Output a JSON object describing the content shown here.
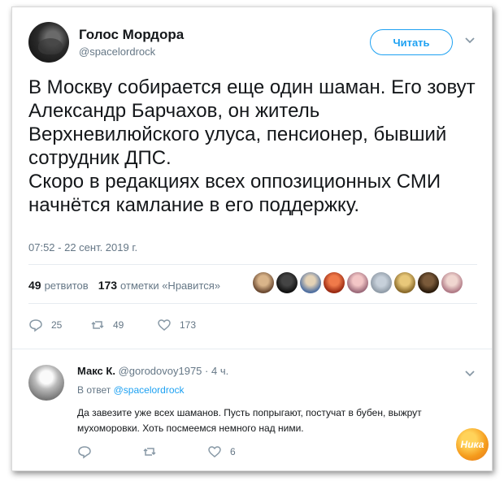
{
  "author": {
    "name": "Голос Мордора",
    "handle": "@spacelordrock"
  },
  "follow_label": "Читать",
  "tweet_text": "В  Москву собирается еще один шаман. Его зовут Александр Барчахов, он житель Верхневилюйского улуса, пенсионер, бывший сотрудник ДПС.\nСкоро в редакциях всех оппозиционных СМИ начнётся камлание в его поддержку.",
  "timestamp": "07:52 - 22 сент. 2019 г.",
  "stats": {
    "retweets_count": "49",
    "retweets_label": "ретвитов",
    "likes_count": "173",
    "likes_label": "отметки «Нравится»"
  },
  "likers_icon": "avatar-icon",
  "actions": {
    "replies": "25",
    "retweets": "49",
    "likes": "173"
  },
  "reply": {
    "name": "Макс К.",
    "handle": "@gorodovoy1975",
    "time": "· 4 ч.",
    "reply_to_prefix": "В ответ",
    "reply_to_handle": "@spacelordrock",
    "text": "Да завезите уже всех шаманов. Пусть попрыгают, постучат в бубен, выжрут мухоморовки. Хоть посмеемся немного над ними.",
    "likes": "6"
  },
  "watermark": "Ника",
  "colors": {
    "accent": "#1da1f2",
    "secondary_text": "#657786"
  }
}
